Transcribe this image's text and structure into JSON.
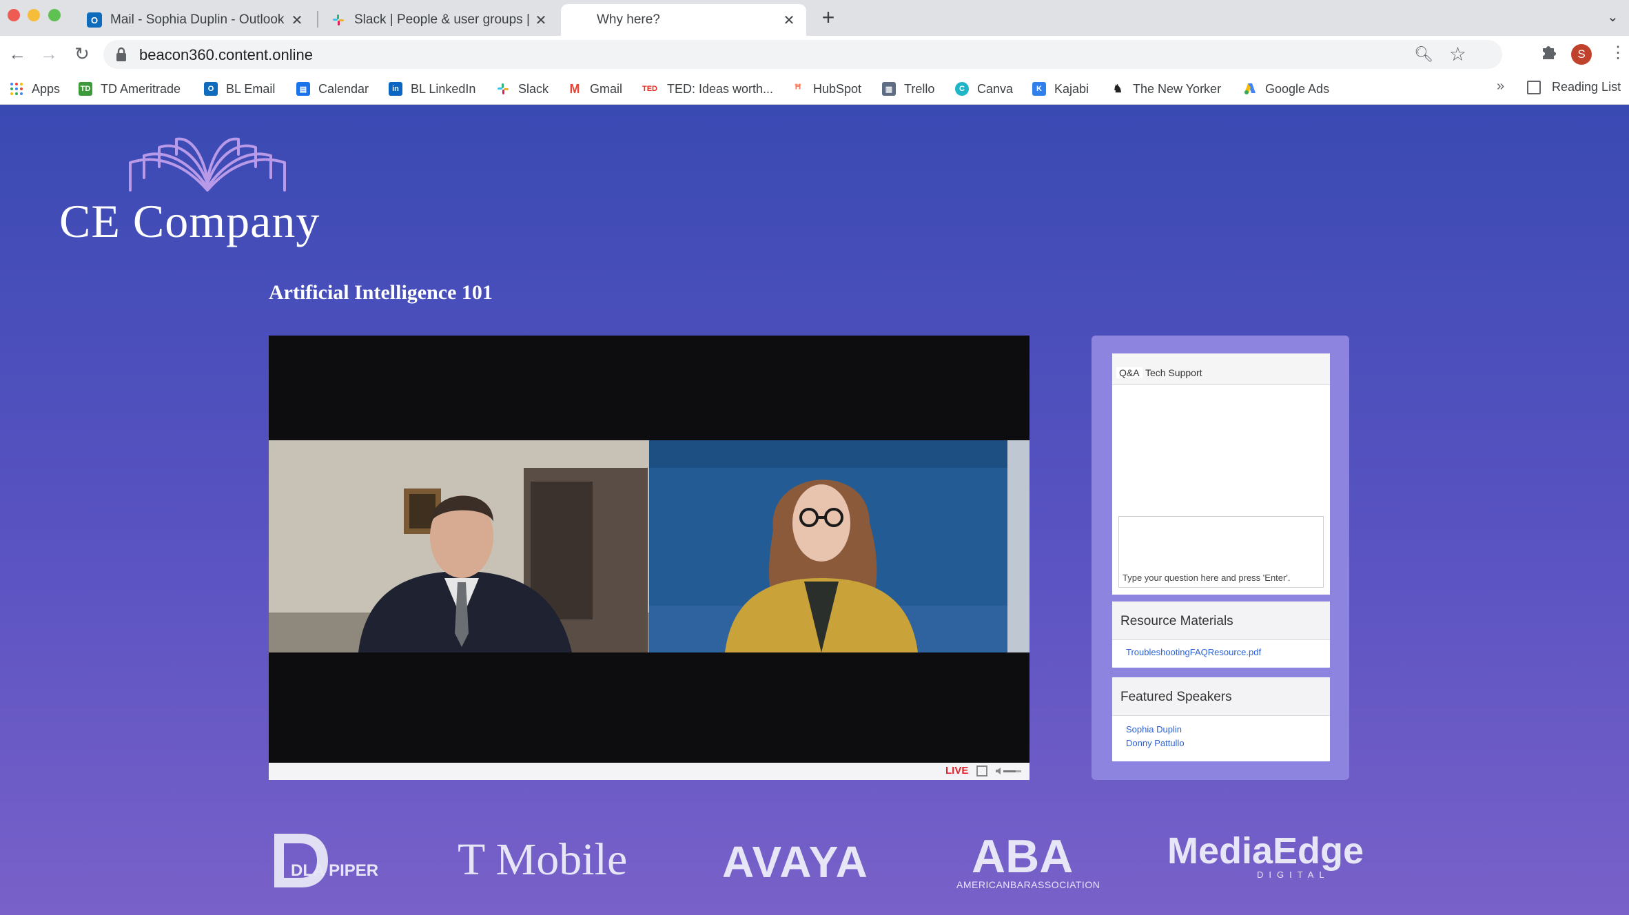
{
  "browser": {
    "tabs": [
      {
        "title": "Mail - Sophia Duplin - Outlook",
        "icon": "outlook-icon",
        "active": false
      },
      {
        "title": "Slack | People & user groups |",
        "icon": "slack-icon",
        "active": false
      },
      {
        "title": "Why here?",
        "icon": "",
        "active": true
      }
    ],
    "new_tab_glyph": "+",
    "url": "beacon360.content.online",
    "profile_initial": "S",
    "bookmarks": [
      {
        "label": "Apps",
        "icon": "apps-grid-icon"
      },
      {
        "label": "TD Ameritrade",
        "icon": "td-icon"
      },
      {
        "label": "BL Email",
        "icon": "outlook-icon"
      },
      {
        "label": "Calendar",
        "icon": "calendar-icon"
      },
      {
        "label": "BL LinkedIn",
        "icon": "linkedin-icon"
      },
      {
        "label": "Slack",
        "icon": "slack-icon"
      },
      {
        "label": "Gmail",
        "icon": "gmail-icon"
      },
      {
        "label": "TED: Ideas worth...",
        "icon": "ted-icon"
      },
      {
        "label": "HubSpot",
        "icon": "hubspot-icon"
      },
      {
        "label": "Trello",
        "icon": "trello-icon"
      },
      {
        "label": "Canva",
        "icon": "canva-icon"
      },
      {
        "label": "Kajabi",
        "icon": "kajabi-icon"
      },
      {
        "label": "The New Yorker",
        "icon": "new-yorker-icon"
      },
      {
        "label": "Google Ads",
        "icon": "google-ads-icon"
      }
    ],
    "bookmarks_overflow": "»",
    "reading_list": "Reading List"
  },
  "page": {
    "brand": "CE Company",
    "event_title": "Artificial Intelligence 101",
    "player": {
      "live_label": "LIVE"
    },
    "qa": {
      "tabs": [
        "Q&A",
        "Tech Support"
      ],
      "placeholder": "Type your question here and press 'Enter'."
    },
    "resources": {
      "title": "Resource Materials",
      "links": [
        "TroubleshootingFAQResource.pdf"
      ]
    },
    "speakers": {
      "title": "Featured Speakers",
      "names": [
        "Sophia Duplin",
        "Donny Pattullo"
      ]
    },
    "sponsors": [
      {
        "name": "DLA PIPER",
        "icon": "dla-piper-logo"
      },
      {
        "name": "T Mobile",
        "icon": "t-mobile-logo"
      },
      {
        "name": "AVAYA",
        "icon": "avaya-logo"
      },
      {
        "name": "ABA",
        "subtitle": "AMERICANBARASSOCIATION",
        "icon": "aba-logo"
      },
      {
        "name": "MediaEdge",
        "subtitle": "DIGITAL",
        "icon": "mediaedge-logo"
      }
    ]
  },
  "colors": {
    "page_bg_top": "#3a4ab3",
    "page_bg_bottom": "#7961c9",
    "side_panel": "#8d84df",
    "live_red": "#e0222b",
    "link_blue": "#2b60d6",
    "brand_accent": "#b89ae8"
  }
}
